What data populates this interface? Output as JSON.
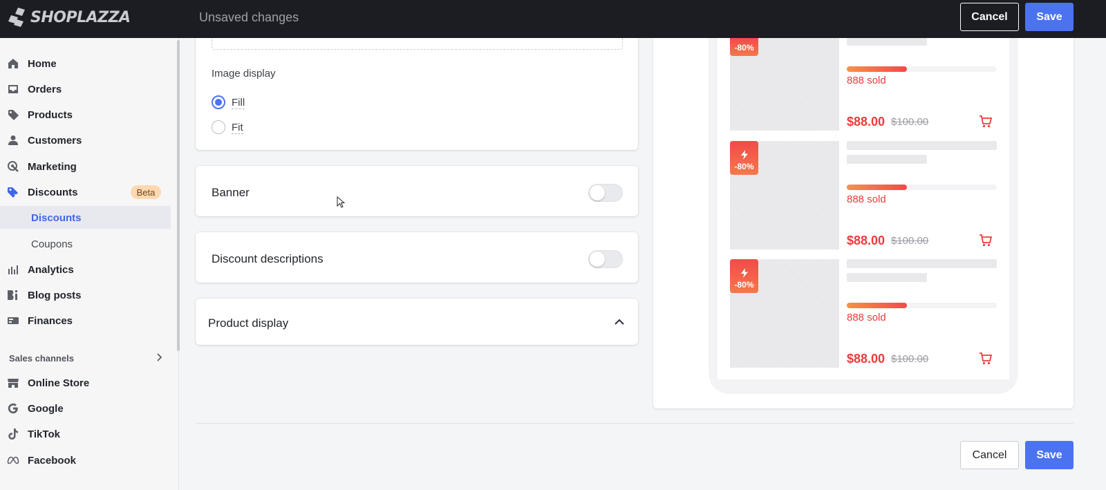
{
  "app": {
    "brand": "SHOPLAZZA",
    "status": "Unsaved changes",
    "cancel_label": "Cancel",
    "save_label": "Save",
    "accent_color": "#4b73f0"
  },
  "sidebar": {
    "items": [
      {
        "label": "Home",
        "icon": "home-icon"
      },
      {
        "label": "Orders",
        "icon": "inbox-icon"
      },
      {
        "label": "Products",
        "icon": "tag-icon"
      },
      {
        "label": "Customers",
        "icon": "person-icon"
      },
      {
        "label": "Marketing",
        "icon": "target-icon"
      },
      {
        "label": "Discounts",
        "icon": "discount-tag-icon",
        "badge": "Beta"
      },
      {
        "label": "Discounts",
        "sub": true,
        "active": true
      },
      {
        "label": "Coupons",
        "sub": true
      },
      {
        "label": "Analytics",
        "icon": "bar-chart-icon"
      },
      {
        "label": "Blog posts",
        "icon": "blog-icon"
      },
      {
        "label": "Finances",
        "icon": "finance-icon"
      }
    ],
    "section_label": "Sales channels",
    "channels": [
      {
        "label": "Online Store",
        "icon": "store-icon"
      },
      {
        "label": "Google",
        "icon": "google-icon"
      },
      {
        "label": "TikTok",
        "icon": "tiktok-icon"
      },
      {
        "label": "Facebook",
        "icon": "meta-icon"
      }
    ]
  },
  "settings": {
    "image_display": {
      "label": "Image display",
      "options": [
        {
          "label": "Fill",
          "selected": true
        },
        {
          "label": "Fit",
          "selected": false
        }
      ]
    },
    "banner": {
      "title": "Banner",
      "enabled": false
    },
    "discount_descriptions": {
      "title": "Discount descriptions",
      "enabled": false
    },
    "product_display": {
      "title": "Product display",
      "expanded": true
    }
  },
  "preview": {
    "products": [
      {
        "badge": "-80%",
        "sold": "888 sold",
        "price": "$88.00",
        "original_price": "$100.00",
        "progress": 0.4
      },
      {
        "badge": "-80%",
        "sold": "888 sold",
        "price": "$88.00",
        "original_price": "$100.00",
        "progress": 0.4
      },
      {
        "badge": "-80%",
        "sold": "888 sold",
        "price": "$88.00",
        "original_price": "$100.00",
        "progress": 0.4
      }
    ],
    "price_color": "#ec3b3b"
  },
  "footer": {
    "cancel_label": "Cancel",
    "save_label": "Save"
  }
}
